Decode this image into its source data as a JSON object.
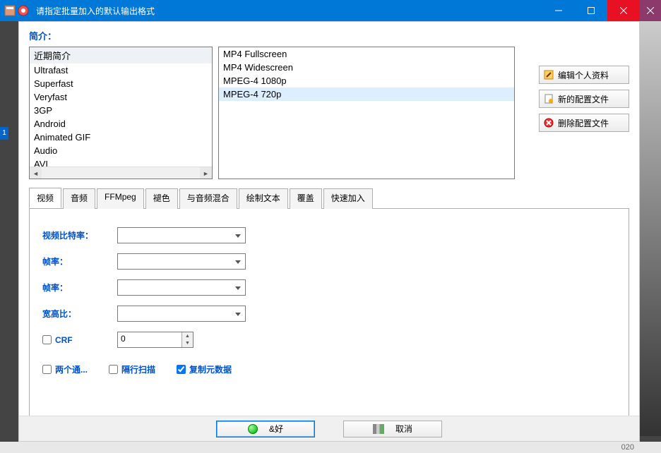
{
  "title": "请指定批量加入的默认输出格式",
  "section_label": "简介：",
  "side_chip": "1",
  "left_list": {
    "header": "近期简介",
    "items": [
      "Ultrafast",
      "Superfast",
      "Veryfast",
      "3GP",
      "Android",
      "Animated GIF",
      "Audio",
      "AVI"
    ]
  },
  "right_list": {
    "items": [
      "MP4 Fullscreen",
      "MP4 Widescreen",
      "MPEG-4 1080p",
      "MPEG-4 720p"
    ],
    "selected_index": 3
  },
  "side_buttons": {
    "edit": "编辑个人资料",
    "newp": "新的配置文件",
    "del": "删除配置文件"
  },
  "tabs": [
    "视频",
    "音频",
    "FFMpeg",
    "褪色",
    "与音频混合",
    "绘制文本",
    "覆盖",
    "快速加入"
  ],
  "active_tab": 0,
  "video_tab": {
    "bitrate_label": "视频比特率：",
    "fps1_label": "帧率：",
    "fps2_label": "帧率：",
    "aspect_label": "宽高比：",
    "crf_label": "CRF",
    "crf_value": "0",
    "two_pass": "两个通...",
    "interlace": "隔行扫描",
    "copy_meta": "复制元数据"
  },
  "footer": {
    "ok": "&好",
    "cancel": "取消"
  },
  "bg_year": "020"
}
